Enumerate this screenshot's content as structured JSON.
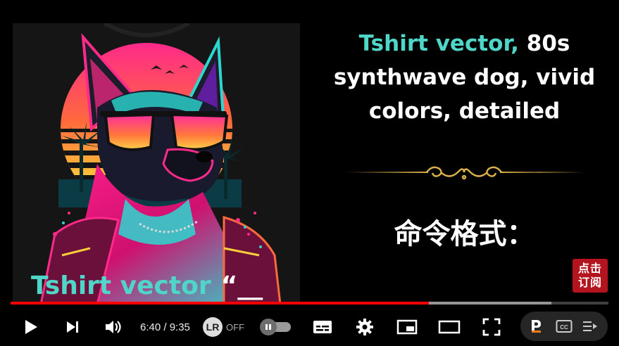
{
  "video": {
    "prompt": {
      "highlight": "Tshirt vector,",
      "line1_rest": " 80s",
      "line2": "synthwave dog, vivid",
      "line3": "colors, detailed"
    },
    "command_label": "命令格式：",
    "command_example": "Tshirt vector",
    "command_example_quote": "“__",
    "subscribe_badge_line1": "点击",
    "subscribe_badge_line2": "订阅"
  },
  "player": {
    "progress_played_fraction": 0.7,
    "progress_loaded_fraction": 0.905,
    "time_display": "6:40 / 9:35",
    "extension_logo": "LR",
    "extension_state": "OFF",
    "autoplay_on": false
  },
  "icons": {
    "play": "play-icon",
    "next": "next-icon",
    "volume": "volume-icon",
    "subtitles": "subtitles-icon",
    "settings": "gear-icon",
    "miniplayer": "miniplayer-icon",
    "theater": "theater-icon",
    "fullscreen": "fullscreen-icon",
    "extension_r": "r-icon",
    "cc": "cc-icon",
    "chapters": "chapters-icon"
  },
  "colors": {
    "accent_teal": "#4fd6c8",
    "progress_red": "#ff0000",
    "badge_red": "#b3141d"
  }
}
